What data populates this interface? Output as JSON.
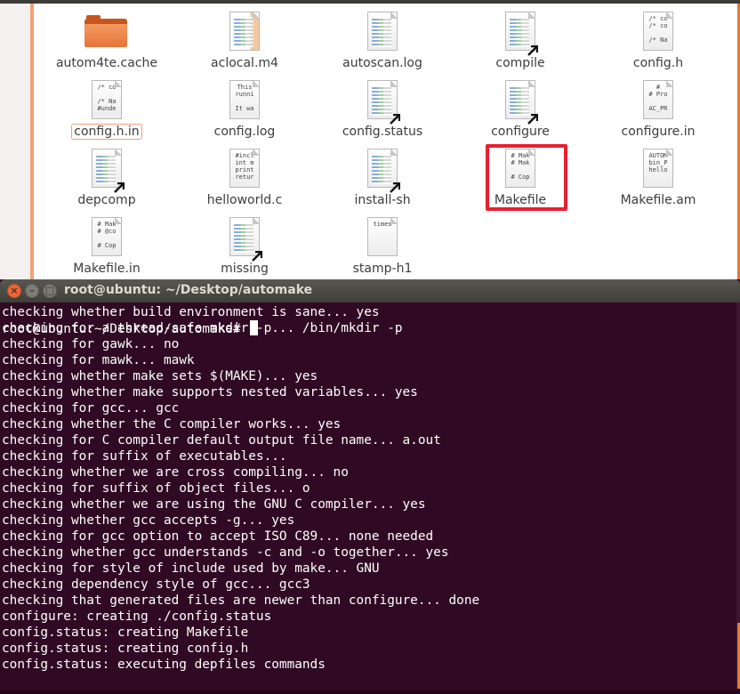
{
  "file_manager": {
    "files": [
      {
        "name": "autom4te.cache",
        "type": "folder"
      },
      {
        "name": "aclocal.m4",
        "type": "m4"
      },
      {
        "name": "autoscan.log",
        "type": "text"
      },
      {
        "name": "compile",
        "type": "script"
      },
      {
        "name": "config.h",
        "type": "text",
        "preview": "/* co\n/* co\n\n/* Na"
      },
      {
        "name": "config.h.in",
        "type": "text",
        "preview": "/* co\n\n/* Na\n#unde",
        "selected": true
      },
      {
        "name": "config.log",
        "type": "text",
        "preview": "This\nrunni\n\nIt wa"
      },
      {
        "name": "config.status",
        "type": "script"
      },
      {
        "name": "configure",
        "type": "script"
      },
      {
        "name": "configure.in",
        "type": "text",
        "preview": "#\n# Pro\n\nAC_PR"
      },
      {
        "name": "depcomp",
        "type": "script"
      },
      {
        "name": "helloworld.c",
        "type": "text",
        "preview": "#incl\nint m\nprint\nretur"
      },
      {
        "name": "install-sh",
        "type": "script"
      },
      {
        "name": "Makefile",
        "type": "text",
        "preview": "# Mak\n# Mak\n\n# Cop",
        "highlighted": true
      },
      {
        "name": "Makefile.am",
        "type": "text",
        "preview": "AUTOM\nbin_P\nhello"
      },
      {
        "name": "Makefile.in",
        "type": "text",
        "preview": "# Mak\n# @co\n\n# Cop"
      },
      {
        "name": "missing",
        "type": "script"
      },
      {
        "name": "stamp-h1",
        "type": "text",
        "preview": "times"
      }
    ]
  },
  "terminal": {
    "title": "root@ubuntu: ~/Desktop/automake",
    "lines": [
      "checking whether build environment is sane... yes",
      "checking for a thread-safe mkdir -p... /bin/mkdir -p",
      "checking for gawk... no",
      "checking for mawk... mawk",
      "checking whether make sets $(MAKE)... yes",
      "checking whether make supports nested variables... yes",
      "checking for gcc... gcc",
      "checking whether the C compiler works... yes",
      "checking for C compiler default output file name... a.out",
      "checking for suffix of executables...",
      "checking whether we are cross compiling... no",
      "checking for suffix of object files... o",
      "checking whether we are using the GNU C compiler... yes",
      "checking whether gcc accepts -g... yes",
      "checking for gcc option to accept ISO C89... none needed",
      "checking whether gcc understands -c and -o together... yes",
      "checking for style of include used by make... GNU",
      "checking dependency style of gcc... gcc3",
      "checking that generated files are newer than configure... done",
      "configure: creating ./config.status",
      "config.status: creating Makefile",
      "config.status: creating config.h",
      "config.status: executing depfiles commands"
    ],
    "prompt": "root@ubuntu:~/Desktop/automake#"
  },
  "colors": {
    "terminal_bg": "#300a24",
    "accent": "#e07a3a",
    "highlight_box": "#e8202f"
  }
}
